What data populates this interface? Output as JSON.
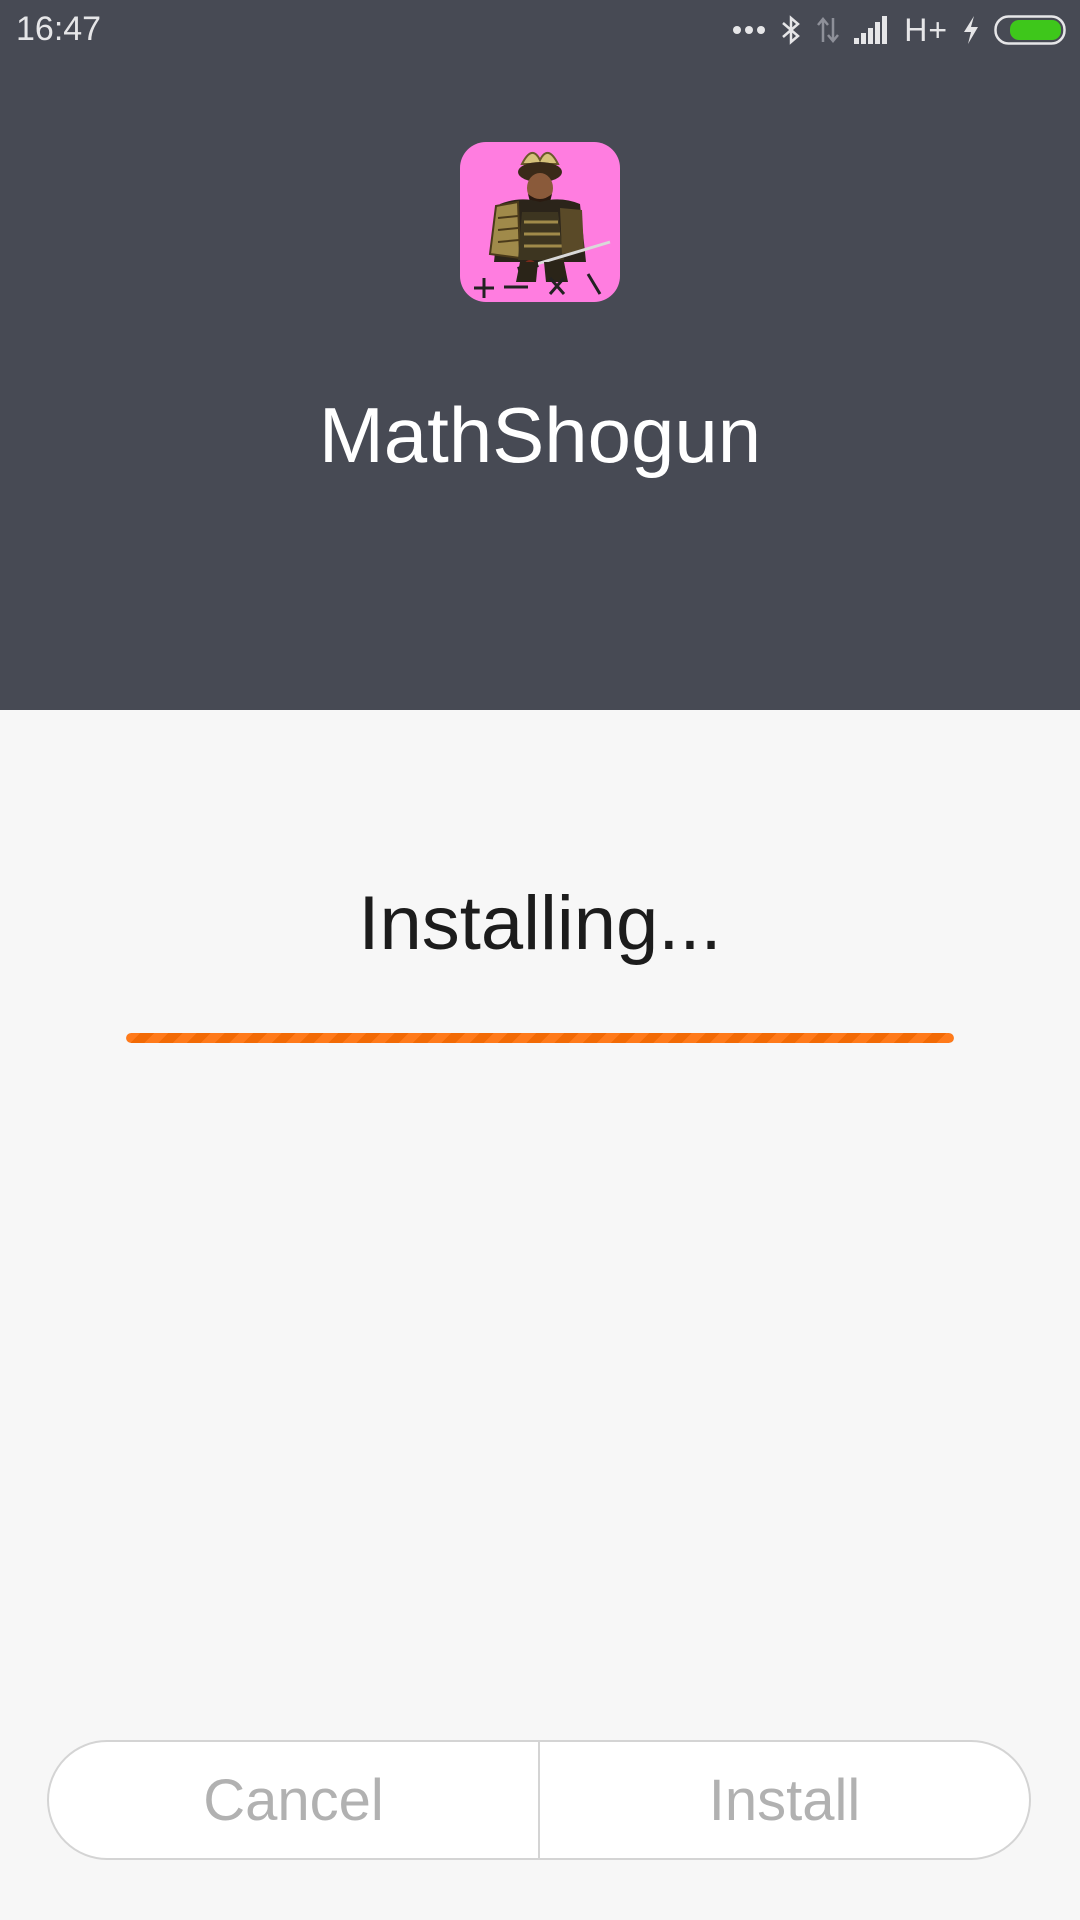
{
  "status_bar": {
    "time": "16:47",
    "network_type": "H+",
    "icons": [
      "more-dots-icon",
      "bluetooth-icon",
      "data-transfer-icon",
      "signal-icon",
      "charging-icon",
      "battery-icon"
    ],
    "battery_color": "#3ec71b"
  },
  "app": {
    "name": "MathShogun",
    "icon": "samurai-app-icon",
    "icon_background": "#ff7de0",
    "icon_symbols": "+ − × \\"
  },
  "install": {
    "status": "Installing...",
    "progress": 1.0,
    "progress_color": "#ff7a1a"
  },
  "buttons": {
    "cancel_label": "Cancel",
    "install_label": "Install"
  },
  "colors": {
    "header_bg": "#474a54",
    "body_bg": "#f7f7f7",
    "disabled_text": "#b1b1b1"
  }
}
